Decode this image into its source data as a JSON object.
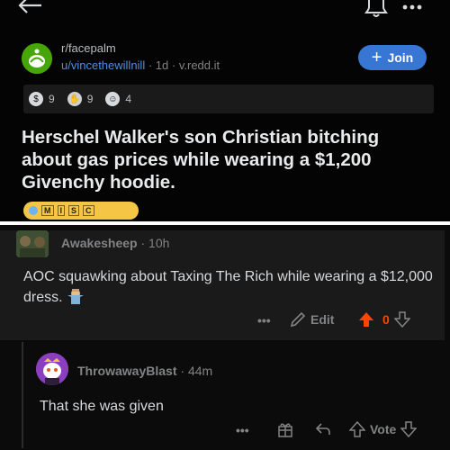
{
  "post": {
    "subreddit": "r/facepalm",
    "author": "u/vincethewillnill",
    "age": "1d",
    "domain": "v.redd.it",
    "join_label": "Join",
    "awards": [
      {
        "icon": "silver-award-icon",
        "count": "9"
      },
      {
        "icon": "helpful-award-icon",
        "count": "9"
      },
      {
        "icon": "wholesome-award-icon",
        "count": "4"
      }
    ],
    "title": "Herschel Walker's son Christian bitching about gas prices while wearing a $1,200 Givenchy hoodie.",
    "flair": [
      "M",
      "I",
      "S",
      "C"
    ]
  },
  "comment": {
    "author": "Awakesheep",
    "age": "10h",
    "body": "AOC squawking about Taxing The Rich while wearing a $12,000 dress.",
    "edit_label": "Edit",
    "score": "0"
  },
  "reply": {
    "author": "ThrowawayBlast",
    "age": "44m",
    "body": "That she was given",
    "vote_label": "Vote"
  },
  "colors": {
    "accent_blue": "#3777d3",
    "upvote_orange": "#ff4500",
    "flair_yellow": "#f5c646"
  }
}
